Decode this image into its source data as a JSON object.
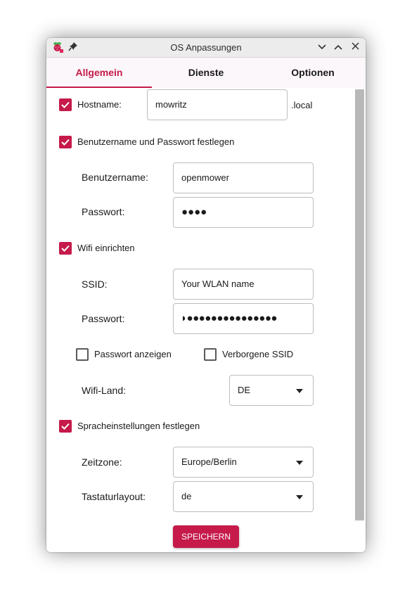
{
  "window": {
    "title": "OS Anpassungen"
  },
  "tabs": [
    {
      "label": "Allgemein",
      "active": true
    },
    {
      "label": "Dienste",
      "active": false
    },
    {
      "label": "Optionen",
      "active": false
    }
  ],
  "hostname": {
    "checkbox_label": "Hostname:",
    "checked": true,
    "value": "mowritz",
    "suffix": ".local"
  },
  "user": {
    "checkbox_label": "Benutzername und Passwort festlegen",
    "checked": true,
    "username_label": "Benutzername:",
    "username_value": "openmower",
    "password_label": "Passwort:",
    "password_value": "●●●●"
  },
  "wifi": {
    "checkbox_label": "Wifi einrichten",
    "checked": true,
    "ssid_label": "SSID:",
    "ssid_value": "Your WLAN name",
    "password_label": "Passwort:",
    "password_value": "◗●●●●●●●●●●●●●●●",
    "show_password_label": "Passwort anzeigen",
    "show_password_checked": false,
    "hidden_ssid_label": "Verborgene SSID",
    "hidden_ssid_checked": false,
    "country_label": "Wifi-Land:",
    "country_value": "DE"
  },
  "locale": {
    "checkbox_label": "Spracheinstellungen festlegen",
    "checked": true,
    "timezone_label": "Zeitzone:",
    "timezone_value": "Europe/Berlin",
    "keyboard_label": "Tastaturlayout:",
    "keyboard_value": "de"
  },
  "actions": {
    "save_label": "SPEICHERN"
  },
  "colors": {
    "accent": "#c51a4a",
    "titlebar": "#ececec",
    "tabbar": "#fcf7fa",
    "scrollbar": "#b8b8b8"
  }
}
